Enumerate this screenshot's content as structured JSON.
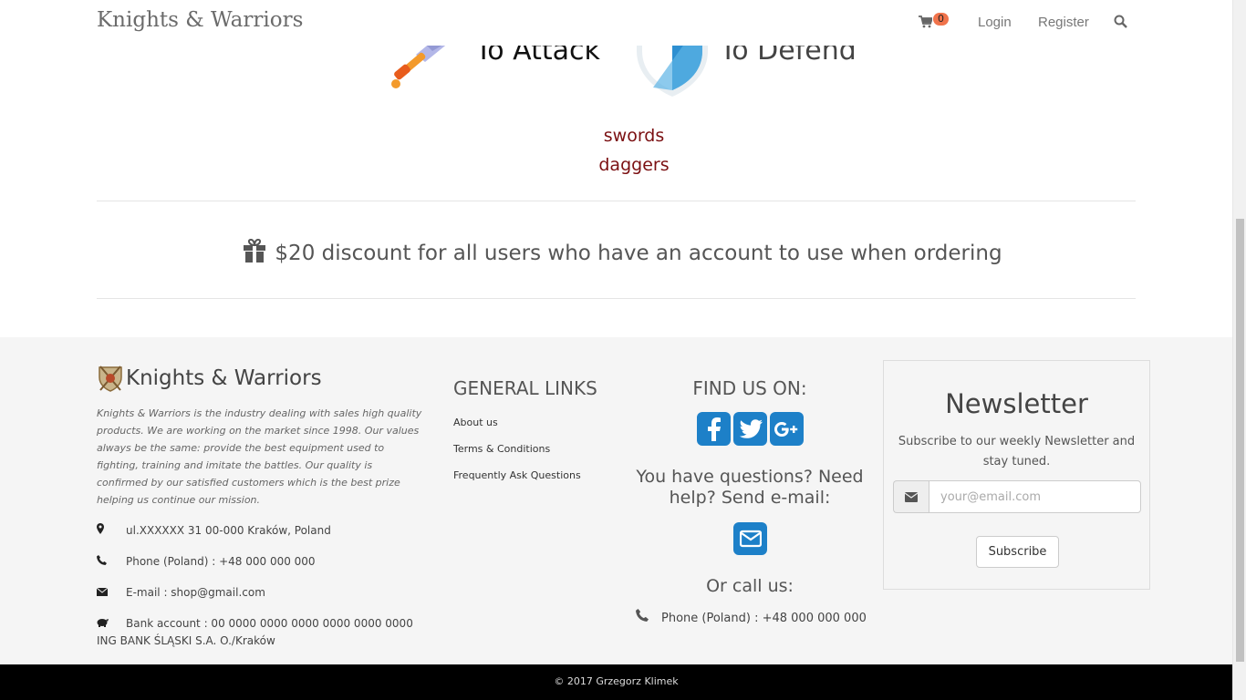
{
  "header": {
    "brand": "Knights & Warriors",
    "cart_count": "0",
    "login": "Login",
    "register": "Register",
    "icons": [
      "cart-icon",
      "search-icon"
    ]
  },
  "hero": {
    "attack_title": "To Attack",
    "defend_title": "To Defend",
    "categories": [
      "swords",
      "daggers"
    ]
  },
  "promo": {
    "text": "$20 discount for all users who have an account to use when ordering"
  },
  "footer": {
    "brand": "Knights & Warriors",
    "about": "Knights & Warriors is the industry dealing with sales high quality products. We are working on the market since 1998. Our values always be the same: provide the best equipment used to fighting, training and imitate the battles. Our quality is confirmed by our satisfied customers which is the best prize helping us continue our mission.",
    "address": "ul.XXXXXX 31 00-000 Kraków, Poland",
    "phone": "Phone (Poland) : +48 000 000 000",
    "email": "E-mail : shop@gmail.com",
    "bank": "Bank account : 00 0000 0000 0000 0000 0000 0000 ING BANK ŚLĄSKI S.A. O./Kraków",
    "general_links_title": "GENERAL LINKS",
    "links": [
      "About us",
      "Terms & Conditions",
      "Frequently Ask Questions"
    ],
    "find_us_title": "FIND US ON:",
    "help_text": "You have questions? Need help? Send e-mail:",
    "call_title": "Or call us:",
    "call_phone": "Phone (Poland) : +48 000 000 000",
    "newsletter": {
      "title": "Newsletter",
      "subtitle": "Subscribe to our weekly Newsletter and stay tuned.",
      "placeholder": "your@email.com",
      "button": "Subscribe"
    },
    "copyright": "© 2017 Grzegorz Klimek"
  },
  "colors": {
    "accent_blue": "#1d80c8",
    "category_red": "#7b1012",
    "badge_orange": "#f0734b"
  }
}
